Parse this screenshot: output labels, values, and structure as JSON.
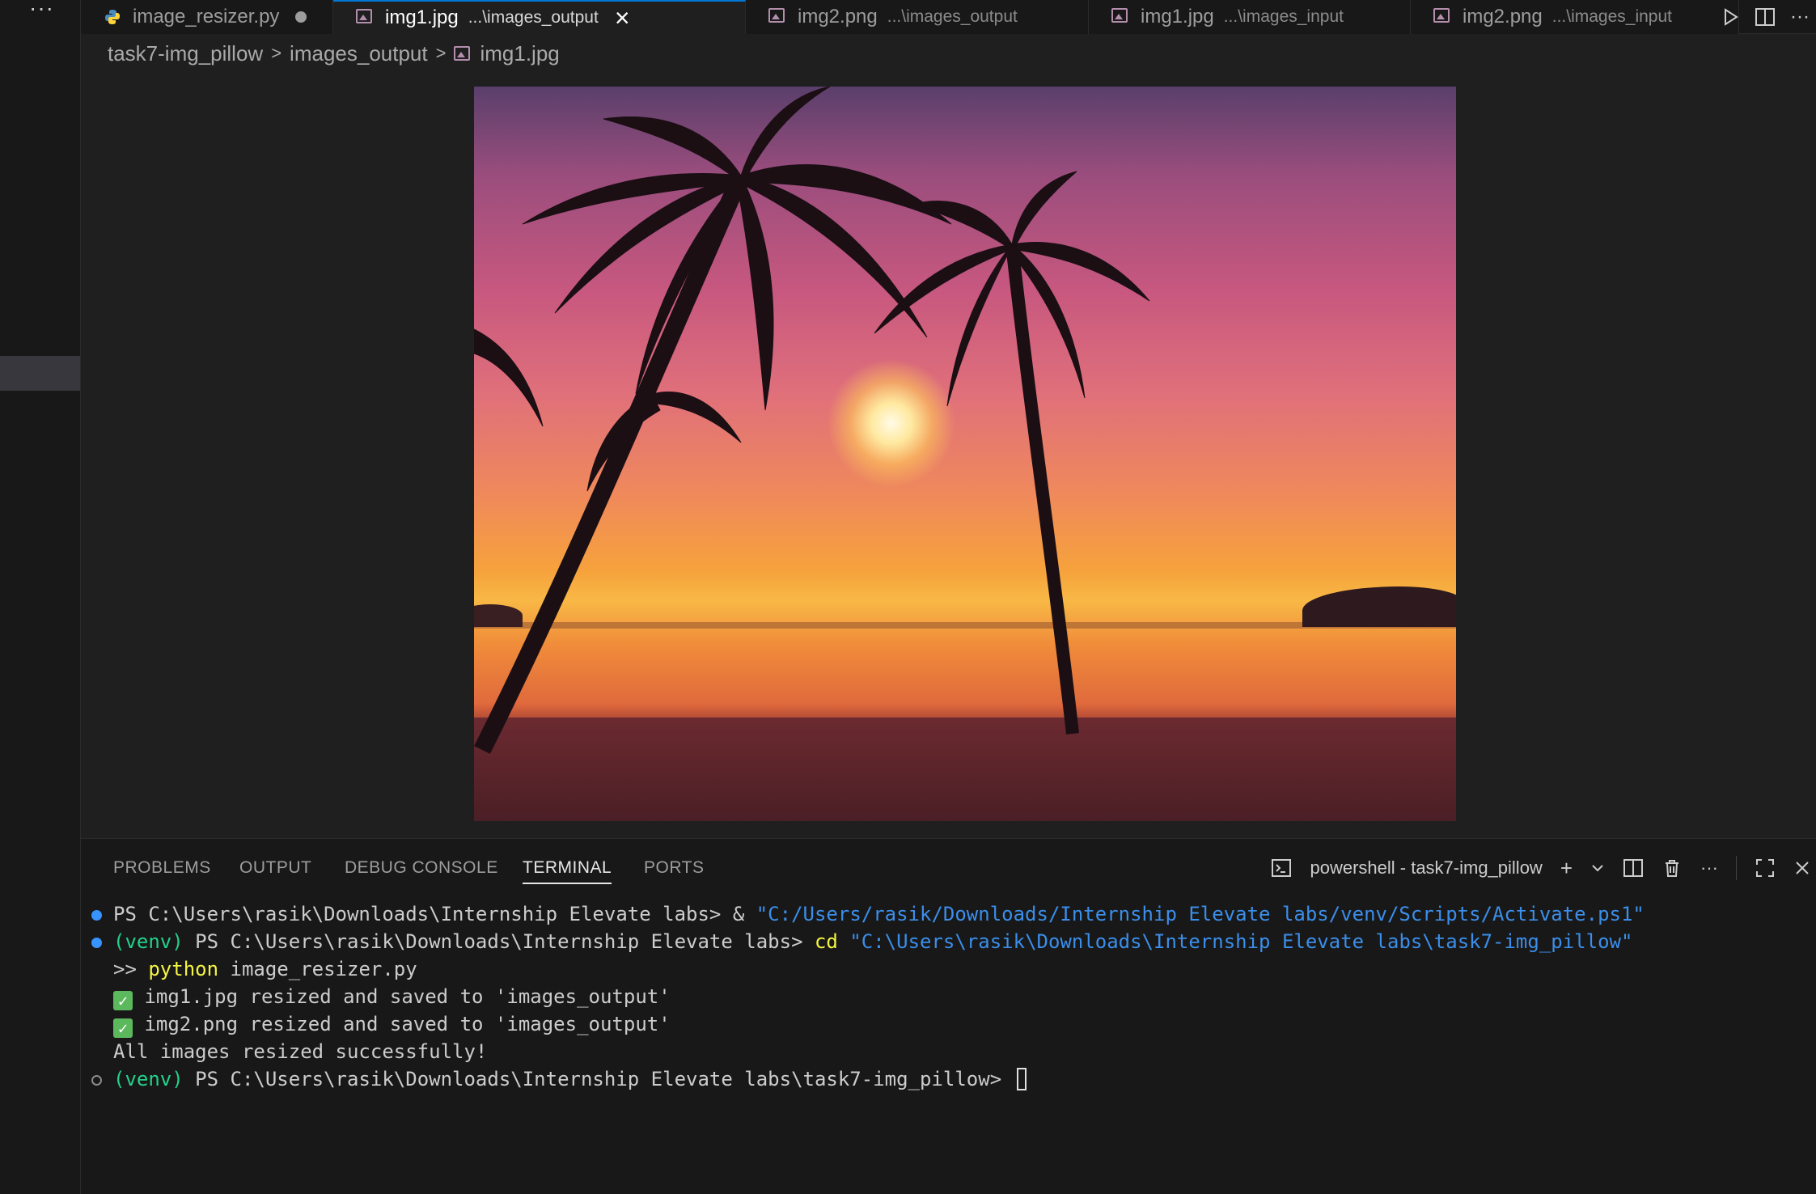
{
  "activity_bar": {
    "more_label": "···"
  },
  "tabs": [
    {
      "name": "image_resizer.py",
      "desc": "",
      "dirty": true
    },
    {
      "name": "img1.jpg",
      "desc": "...\\images_output",
      "active": true
    },
    {
      "name": "img2.png",
      "desc": "...\\images_output"
    },
    {
      "name": "img1.jpg",
      "desc": "...\\images_input"
    },
    {
      "name": "img2.png",
      "desc": "...\\images_input"
    }
  ],
  "editor_actions": {
    "more_label": "···"
  },
  "breadcrumb": {
    "root": "task7-img_pillow",
    "folder": "images_output",
    "file": "img1.jpg"
  },
  "panel": {
    "tabs": [
      "PROBLEMS",
      "OUTPUT",
      "DEBUG CONSOLE",
      "TERMINAL",
      "PORTS"
    ],
    "active_tab": "TERMINAL",
    "terminal_name": "powershell - task7-img_pillow",
    "more_label": "···"
  },
  "terminal": {
    "line1_prompt": "PS C:\\Users\\rasik\\Downloads\\Internship Elevate labs> ",
    "line1_amp": "& ",
    "line1_path": "\"C:/Users/rasik/Downloads/Internship Elevate labs/venv/Scripts/Activate.ps1\"",
    "line2_venv": "(venv)",
    "line2_prompt": " PS C:\\Users\\rasik\\Downloads\\Internship Elevate labs> ",
    "line2_cmd": "cd ",
    "line2_path": "\"C:\\Users\\rasik\\Downloads\\Internship Elevate labs\\task7-img_pillow\"",
    "line3_prefix": ">> ",
    "line3_cmd": "python",
    "line3_arg": " image_resizer.py",
    "line4_text": " img1.jpg resized and saved to 'images_output'",
    "line5_text": " img2.png resized and saved to 'images_output'",
    "line6_text": "All images resized successfully!",
    "line7_venv": "(venv)",
    "line7_prompt": " PS C:\\Users\\rasik\\Downloads\\Internship Elevate labs\\task7-img_pillow> "
  }
}
